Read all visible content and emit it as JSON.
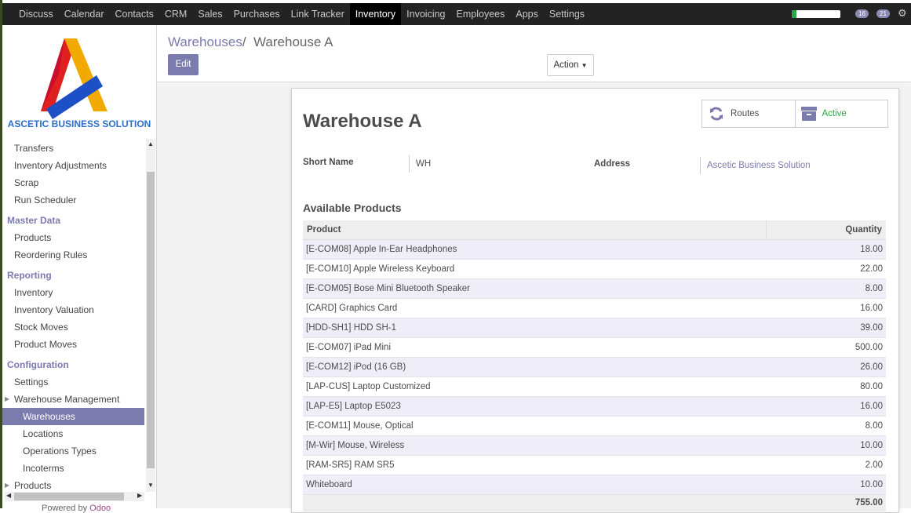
{
  "topbar": {
    "menu": [
      "Discuss",
      "Calendar",
      "Contacts",
      "CRM",
      "Sales",
      "Purchases",
      "Link Tracker",
      "Inventory",
      "Invoicing",
      "Employees",
      "Apps",
      "Settings"
    ],
    "active": "Inventory",
    "progress": 0.1,
    "badge_activities": "16",
    "badge_messages": "21"
  },
  "sidebar": {
    "logo_text": "ASCETIC BUSINESS SOLUTION",
    "items": [
      {
        "label": "Transfers",
        "kind": "item"
      },
      {
        "label": "Inventory Adjustments",
        "kind": "item"
      },
      {
        "label": "Scrap",
        "kind": "item"
      },
      {
        "label": "Run Scheduler",
        "kind": "item"
      },
      {
        "label": "Master Data",
        "kind": "head"
      },
      {
        "label": "Products",
        "kind": "item"
      },
      {
        "label": "Reordering Rules",
        "kind": "item"
      },
      {
        "label": "Reporting",
        "kind": "head"
      },
      {
        "label": "Inventory",
        "kind": "item"
      },
      {
        "label": "Inventory Valuation",
        "kind": "item"
      },
      {
        "label": "Stock Moves",
        "kind": "item"
      },
      {
        "label": "Product Moves",
        "kind": "item"
      },
      {
        "label": "Configuration",
        "kind": "head"
      },
      {
        "label": "Settings",
        "kind": "item"
      },
      {
        "label": "Warehouse Management",
        "kind": "item",
        "expandable": true
      },
      {
        "label": "Warehouses",
        "kind": "sub",
        "selected": true
      },
      {
        "label": "Locations",
        "kind": "sub"
      },
      {
        "label": "Operations Types",
        "kind": "sub"
      },
      {
        "label": "Incoterms",
        "kind": "sub"
      },
      {
        "label": "Products",
        "kind": "item",
        "expandable": true
      }
    ],
    "powered_by": "Powered by",
    "powered_brand": "Odoo"
  },
  "control": {
    "breadcrumb_parent": "Warehouses",
    "breadcrumb_sep": "/",
    "breadcrumb_current": "Warehouse A",
    "edit_label": "Edit",
    "action_label": "Action"
  },
  "form": {
    "routes_label": "Routes",
    "active_label": "Active",
    "title": "Warehouse A",
    "short_name_label": "Short Name",
    "short_name_value": "WH",
    "address_label": "Address",
    "address_value": "Ascetic Business Solution",
    "section_title": "Available Products",
    "col_product": "Product",
    "col_quantity": "Quantity",
    "rows": [
      {
        "product": "[E-COM08] Apple In-Ear Headphones",
        "qty": "18.00"
      },
      {
        "product": "[E-COM10] Apple Wireless Keyboard",
        "qty": "22.00"
      },
      {
        "product": "[E-COM05] Bose Mini Bluetooth Speaker",
        "qty": "8.00"
      },
      {
        "product": "[CARD] Graphics Card",
        "qty": "16.00"
      },
      {
        "product": "[HDD-SH1] HDD SH-1",
        "qty": "39.00"
      },
      {
        "product": "[E-COM07] iPad Mini",
        "qty": "500.00"
      },
      {
        "product": "[E-COM12] iPod (16 GB)",
        "qty": "26.00"
      },
      {
        "product": "[LAP-CUS] Laptop Customized",
        "qty": "80.00"
      },
      {
        "product": "[LAP-E5] Laptop E5023",
        "qty": "16.00"
      },
      {
        "product": "[E-COM11] Mouse, Optical",
        "qty": "8.00"
      },
      {
        "product": "[M-Wir] Mouse, Wireless",
        "qty": "10.00"
      },
      {
        "product": "[RAM-SR5] RAM SR5",
        "qty": "2.00"
      },
      {
        "product": "Whiteboard",
        "qty": "10.00"
      }
    ],
    "total": "755.00"
  }
}
